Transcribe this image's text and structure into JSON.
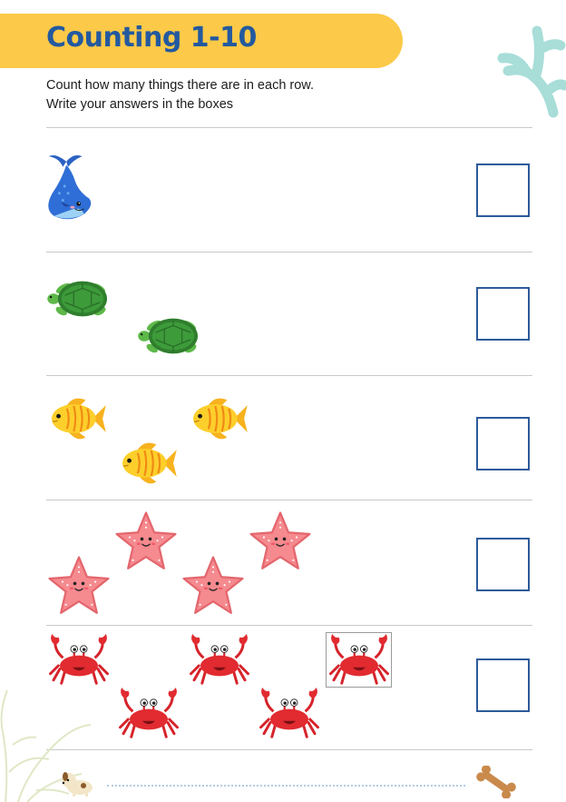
{
  "worksheet": {
    "title": "Counting 1-10",
    "instructions": [
      "Count how many things there are in each row.",
      "Write your answers in the boxes"
    ]
  },
  "rows": [
    {
      "animal": "whale",
      "count": 1
    },
    {
      "animal": "turtle",
      "count": 2
    },
    {
      "animal": "fish",
      "count": 3
    },
    {
      "animal": "starfish",
      "count": 4
    },
    {
      "animal": "crab",
      "count": 5
    }
  ],
  "colors": {
    "title_band": "#fcc948",
    "title_text": "#23599f",
    "answer_box_border": "#2d5a9a",
    "divider": "#c9c9c9",
    "coral": "#a8ddd8"
  },
  "decorations": [
    "coral-icon",
    "seaweed-icon",
    "puppy-icon",
    "bone-icon"
  ]
}
